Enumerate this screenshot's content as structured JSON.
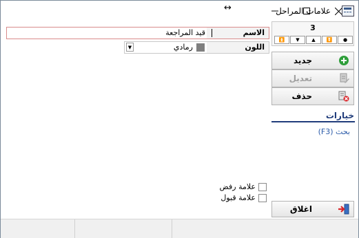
{
  "window": {
    "title": "علامات المراحل",
    "resize_glyph": "↔"
  },
  "nav": {
    "count": "3",
    "buttons": [
      "first",
      "prev",
      "next",
      "last",
      "current"
    ]
  },
  "commands": {
    "new_label": "جديد",
    "edit_label": "تعديل",
    "delete_label": "حذف",
    "close_label": "اغلاق"
  },
  "options": {
    "title": "خيارات",
    "search_link": "بحث (F3)"
  },
  "form": {
    "name_label": "الاسم",
    "name_value": "قيد المراجعة",
    "color_label": "اللون",
    "color_value": "رمادي",
    "color_hex": "#7f7f7f",
    "reject_mark_label": "علامة رفض",
    "accept_mark_label": "علامة قبول",
    "reject_checked": false,
    "accept_checked": false
  },
  "colors": {
    "accent": "#1f3b7a",
    "link": "#2a5aa8",
    "required_border": "#d98b8b"
  }
}
